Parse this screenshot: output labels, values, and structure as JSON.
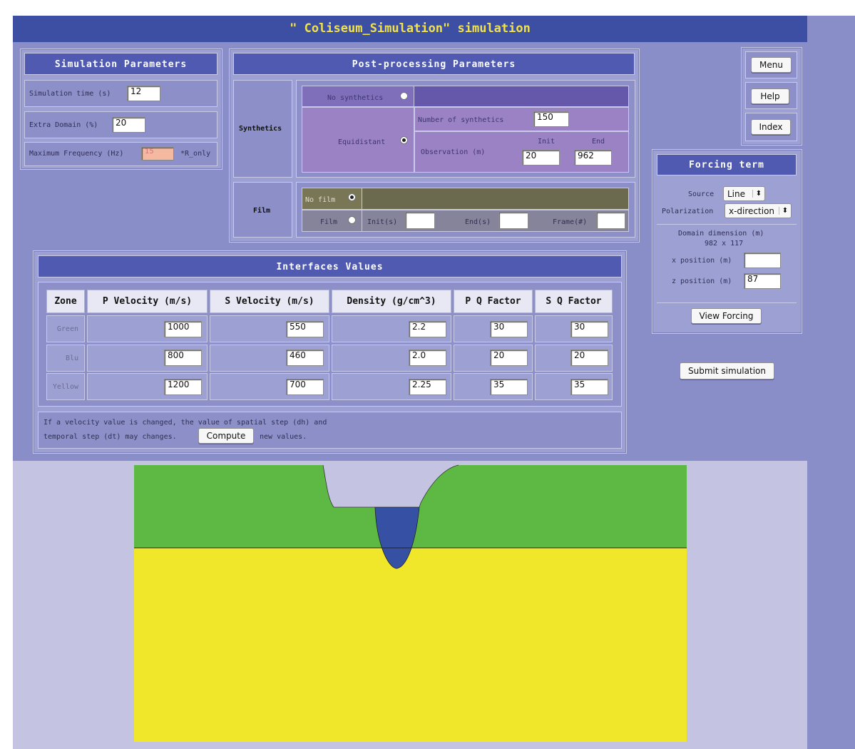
{
  "title": "\" Coliseum_Simulation\" simulation",
  "sim_params": {
    "header": "Simulation Parameters",
    "time_label": "Simulation time (s)",
    "time_value": "12",
    "extra_label": "Extra Domain (%)",
    "extra_value": "20",
    "freq_label": "Maximum Frequency (Hz)",
    "freq_value": "15",
    "freq_note": "*R_only"
  },
  "post": {
    "header": "Post-processing Parameters",
    "synthetics_label": "Synthetics",
    "no_synthetics": "No synthetics",
    "equidistant": "Equidistant",
    "num_synth_label": "Number of synthetics",
    "num_synth_value": "150",
    "init_label": "Init",
    "end_label": "End",
    "observation_label": "Observation (m)",
    "obs_init": "20",
    "obs_end": "962",
    "film_label": "Film",
    "no_film": "No film",
    "film": "Film",
    "init_s": "Init(s)",
    "end_s": "End(s)",
    "frame": "Frame(#)"
  },
  "nav": {
    "menu": "Menu",
    "help": "Help",
    "index": "Index"
  },
  "forcing": {
    "header": "Forcing term",
    "source_label": "Source",
    "source_value": "Line",
    "polarization_label": "Polarization",
    "polarization_value": "x-direction",
    "domain_label": "Domain dimension (m)",
    "domain_value": "982 x 117",
    "xpos_label": "x position (m)",
    "xpos_value": "",
    "zpos_label": "z position (m)",
    "zpos_value": "87",
    "view_button": "View Forcing"
  },
  "submit": "Submit simulation",
  "interfaces": {
    "header": "Interfaces Values",
    "columns": [
      "Zone",
      "P Velocity (m/s)",
      "S Velocity (m/s)",
      "Density (g/cm^3)",
      "P Q Factor",
      "S Q Factor"
    ],
    "rows": [
      {
        "zone": "Green",
        "p": "1000",
        "s": "550",
        "d": "2.2",
        "pq": "30",
        "sq": "30"
      },
      {
        "zone": "Blu",
        "p": "800",
        "s": "460",
        "d": "2.0",
        "pq": "20",
        "sq": "20"
      },
      {
        "zone": "Yellow",
        "p": "1200",
        "s": "700",
        "d": "2.25",
        "pq": "35",
        "sq": "35"
      }
    ],
    "note_1": "If a velocity value is changed, the value of spatial step (dh) and",
    "note_2a": "temporal step (dt) may changes.",
    "compute": "Compute",
    "note_2b": "new values."
  },
  "colors": {
    "green": "#5eb944",
    "blue": "#3651a4",
    "yellow": "#f0e62a",
    "sky": "#c4c4e2"
  }
}
